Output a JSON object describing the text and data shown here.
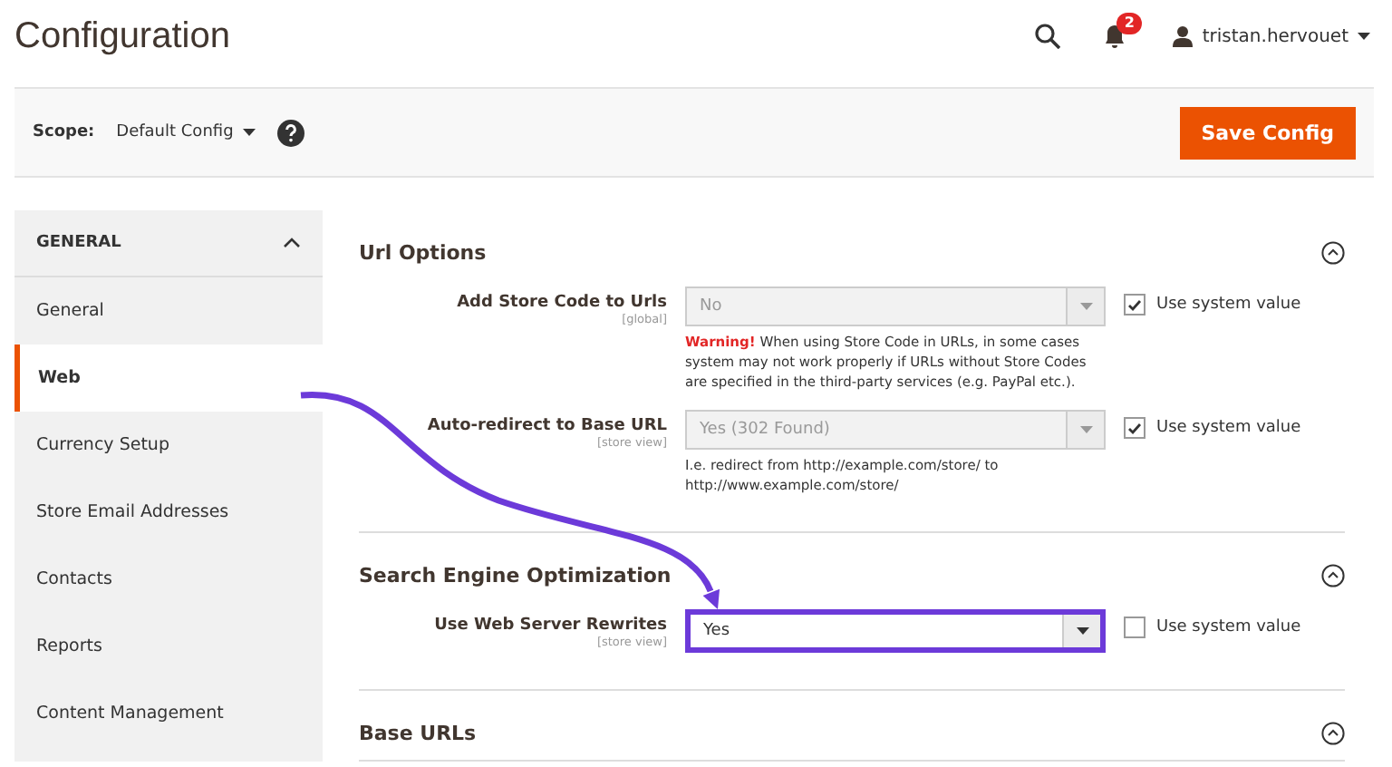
{
  "header": {
    "title": "Configuration",
    "notifications_count": "2",
    "username": "tristan.hervouet"
  },
  "scope_bar": {
    "label": "Scope:",
    "value": "Default Config",
    "save_button": "Save Config"
  },
  "sidebar": {
    "group": {
      "title": "GENERAL",
      "expanded": true
    },
    "items": [
      {
        "label": "General",
        "selected": false
      },
      {
        "label": "Web",
        "selected": true
      },
      {
        "label": "Currency Setup",
        "selected": false
      },
      {
        "label": "Store Email Addresses",
        "selected": false
      },
      {
        "label": "Contacts",
        "selected": false
      },
      {
        "label": "Reports",
        "selected": false
      },
      {
        "label": "Content Management",
        "selected": false
      }
    ]
  },
  "sections": [
    {
      "title": "Url Options",
      "expanded": true,
      "fields": [
        {
          "label": "Add Store Code to Urls",
          "scope": "[global]",
          "value": "No",
          "disabled": true,
          "highlighted": false,
          "use_system_value": true,
          "system_label": "Use system value",
          "note": "**Warning!** When using Store Code in URLs, in some cases system may not work properly if URLs without Store Codes are specified in the third-party services (e.g. PayPal etc.)."
        },
        {
          "label": "Auto-redirect to Base URL",
          "scope": "[store view]",
          "value": "Yes (302 Found)",
          "disabled": true,
          "highlighted": false,
          "use_system_value": true,
          "system_label": "Use system value",
          "note": "I.e. redirect from http://example.com/store/ to http://www.example.com/store/"
        }
      ]
    },
    {
      "title": "Search Engine Optimization",
      "expanded": true,
      "fields": [
        {
          "label": "Use Web Server Rewrites",
          "scope": "[store view]",
          "value": "Yes",
          "disabled": false,
          "highlighted": true,
          "use_system_value": false,
          "system_label": "Use system value"
        }
      ]
    },
    {
      "title": "Base URLs",
      "expanded": true
    }
  ]
}
